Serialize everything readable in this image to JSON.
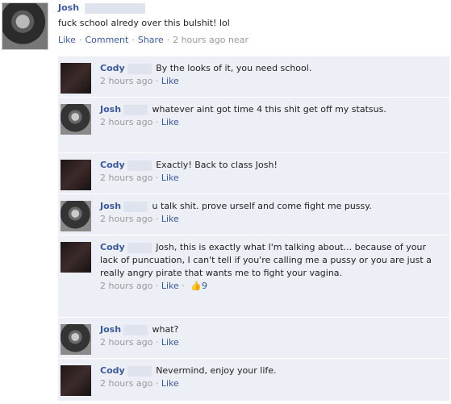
{
  "post": {
    "author": "Josh",
    "text": "fuck school alredy over this bulshit! lol",
    "actions": {
      "like": "Like",
      "comment": "Comment",
      "share": "Share",
      "time": "2 hours ago near"
    }
  },
  "comments": [
    {
      "author": "Cody",
      "text": "By the looks of it, you need school.",
      "time": "2 hours ago",
      "like": "Like"
    },
    {
      "author": "Josh",
      "text": "whatever aint got time 4 this shit get off my statsus.",
      "time": "2 hours ago",
      "like": "Like"
    },
    {
      "author": "Cody",
      "text": "Exactly! Back to class Josh!",
      "time": "2 hours ago",
      "like": "Like"
    },
    {
      "author": "Josh",
      "text": "u talk shit. prove urself and come fight me pussy.",
      "time": "2 hours ago",
      "like": "Like"
    },
    {
      "author": "Cody",
      "text": "Josh, this is exactly what I'm talking about... because of your lack of puncuation, I can't tell if you're calling me a pussy or you are just a really angry pirate that wants me to fight your vagina.",
      "time": "2 hours ago",
      "like": "Like",
      "like_count": "9"
    },
    {
      "author": "Josh",
      "text": "what?",
      "time": "2 hours ago",
      "like": "Like"
    },
    {
      "author": "Cody",
      "text": "Nevermind, enjoy your life.",
      "time": "2 hours ago",
      "like": "Like"
    }
  ]
}
